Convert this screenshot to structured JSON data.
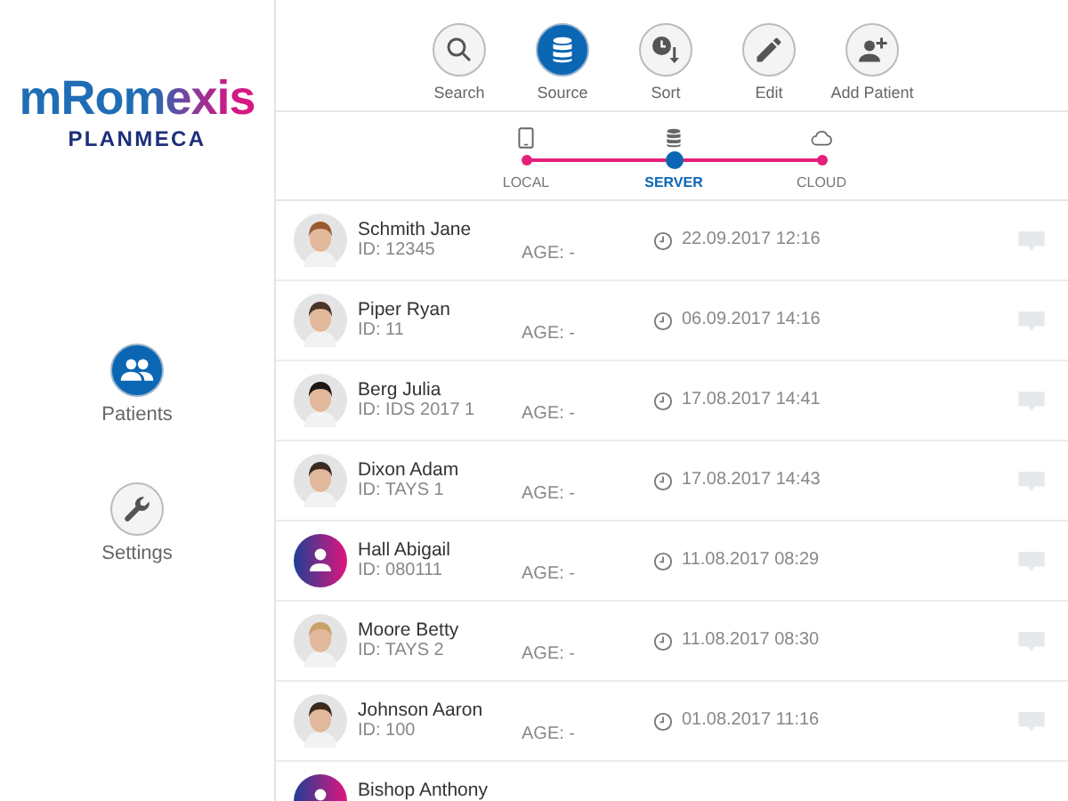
{
  "logo": {
    "product": "mRomexis",
    "brand": "PLANMECA"
  },
  "nav": [
    {
      "label": "Patients",
      "selected": true
    },
    {
      "label": "Settings",
      "selected": false
    }
  ],
  "toolbar": [
    {
      "label": "Search",
      "selected": false
    },
    {
      "label": "Source",
      "selected": true
    },
    {
      "label": "Sort",
      "selected": false
    },
    {
      "label": "Edit",
      "selected": false
    },
    {
      "label": "Add Patient",
      "selected": false
    }
  ],
  "sources": [
    {
      "label": "LOCAL",
      "selected": false
    },
    {
      "label": "SERVER",
      "selected": true
    },
    {
      "label": "CLOUD",
      "selected": false
    }
  ],
  "patients": [
    {
      "name": "Schmith Jane",
      "id": "ID: 12345",
      "age": "AGE: -",
      "date": "22.09.2017 12:16",
      "kind": "photo"
    },
    {
      "name": "Piper Ryan",
      "id": "ID: 11",
      "age": "AGE: -",
      "date": "06.09.2017 14:16",
      "kind": "photo"
    },
    {
      "name": "Berg Julia",
      "id": "ID: IDS 2017 1",
      "age": "AGE: -",
      "date": "17.08.2017 14:41",
      "kind": "photo"
    },
    {
      "name": "Dixon Adam",
      "id": "ID: TAYS 1",
      "age": "AGE: -",
      "date": "17.08.2017 14:43",
      "kind": "photo"
    },
    {
      "name": "Hall Abigail",
      "id": "ID: 080111",
      "age": "AGE: -",
      "date": "11.08.2017 08:29",
      "kind": "placeholder"
    },
    {
      "name": "Moore Betty",
      "id": "ID: TAYS 2",
      "age": "AGE: -",
      "date": "11.08.2017 08:30",
      "kind": "photo"
    },
    {
      "name": "Johnson Aaron",
      "id": "ID: 100",
      "age": "AGE: -",
      "date": "01.08.2017 11:16",
      "kind": "photo"
    },
    {
      "name": "Bishop Anthony",
      "kind": "placeholder"
    }
  ]
}
